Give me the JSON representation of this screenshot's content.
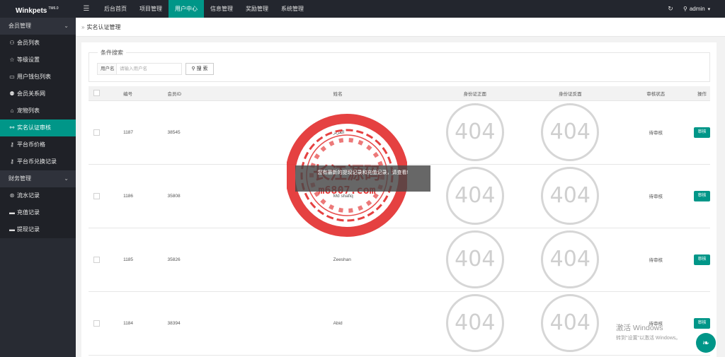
{
  "app": {
    "name": "Winkpets",
    "version": "TM6.0"
  },
  "topnav": {
    "items": [
      "后台首页",
      "项目管理",
      "用户中心",
      "信息管理",
      "奖励管理",
      "系统管理"
    ],
    "user": "admin"
  },
  "sidebar": {
    "group1": "会员管理",
    "group1_items": [
      "会员列表",
      "等级设置",
      "用户钱包列表",
      "会员关系网",
      "宠物列表",
      "实名认证审核",
      "平台币价格",
      "平台币兑换记录"
    ],
    "group2": "财务管理",
    "group2_items": [
      "流水记录",
      "充值记录",
      "提现记录"
    ]
  },
  "breadcrumb": "实名认证管理",
  "search": {
    "legend": "条件搜索",
    "label": "用户名",
    "placeholder": "请输入用户名",
    "button": "搜 索"
  },
  "table": {
    "headers": [
      "编号",
      "会员ID",
      "姓名",
      "身份证正面",
      "身份证反面",
      "审核状态",
      "操作"
    ],
    "rows": [
      {
        "id": "1187",
        "member_id": "38545",
        "name": "العزيز",
        "front": "404",
        "back": "404",
        "status": "待审核",
        "action": "审核"
      },
      {
        "id": "1186",
        "member_id": "35808",
        "name": "Md shafiq",
        "front": "404",
        "back": "404",
        "status": "待审核",
        "action": "审核"
      },
      {
        "id": "1185",
        "member_id": "35826",
        "name": "Zeeshan",
        "front": "404",
        "back": "404",
        "status": "待审核",
        "action": "审核"
      },
      {
        "id": "1184",
        "member_id": "38394",
        "name": "Abid",
        "front": "404",
        "back": "404",
        "status": "待审核",
        "action": "审核"
      }
    ]
  },
  "toast": "您有最新的提现记录和充值记录，请查看!",
  "watermark": {
    "text": "长江源码",
    "url": "m6807.com",
    "color": "#e02020"
  },
  "windows_activation": {
    "line1": "激活 Windows",
    "line2": "转到\"设置\"以激活 Windows。"
  },
  "colors": {
    "accent": "#009688",
    "topbar": "#23262e",
    "sidebar": "#282b33"
  }
}
